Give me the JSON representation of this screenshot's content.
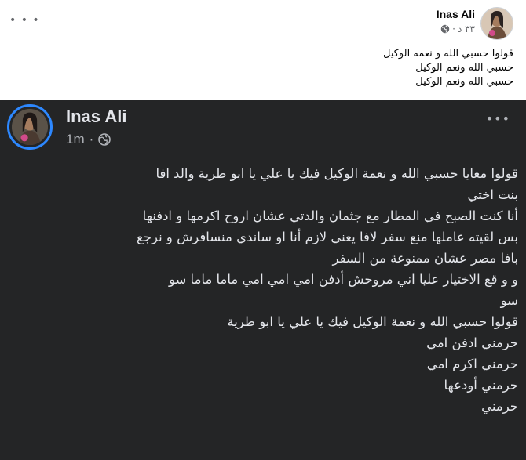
{
  "light_post": {
    "author": "Inas Ali",
    "time": "٣٣ د",
    "lines": [
      "قولوا حسبي الله و نعمه الوكيل",
      "حسبي الله ونعم الوكيل",
      "حسبي الله ونعم الوكيل"
    ]
  },
  "dark_post": {
    "author": "Inas Ali",
    "time": "1m",
    "separator": "·",
    "lines": [
      "قولوا معايا حسبي الله و نعمة الوكيل فيك يا علي يا ابو طرية والد افا",
      "بنت اختي",
      "أنا كنت الصبح في المطار مع جثمان والدتي عشان اروح اكرمها و ادفنها",
      "بس لقيته عاملها منع سفر لافا يعني لازم أنا او ساندي منسافرش و نرجع",
      "بافا مصر عشان ممنوعة من السفر",
      "و و قع الاختيار عليا اني مروحش أدفن امي امي امي ماما ماما سو",
      "سو",
      "قولوا حسبي الله و نعمة الوكيل فيك يا علي يا ابو طرية",
      "حرمني ادفن امي",
      "حرمني اكرم امي",
      "حرمني أودعها",
      "حرمني"
    ]
  },
  "colors": {
    "dark_bg": "#242526",
    "dark_text": "#e4e6eb",
    "dark_secondary": "#b0b3b8",
    "story_ring": "#2d88ff",
    "light_secondary": "#65676b"
  },
  "icons": [
    "more-options-icon",
    "globe-icon",
    "avatar"
  ]
}
